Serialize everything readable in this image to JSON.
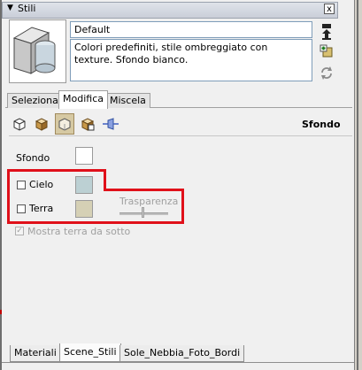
{
  "window": {
    "title": "Stili",
    "close_glyph": "x",
    "title_arrow_glyph": "▼"
  },
  "style_header": {
    "name": "Default",
    "description": "Colori predefiniti, stile ombreggiato con texture. Sfondo bianco."
  },
  "tabs": [
    {
      "label": "Seleziona"
    },
    {
      "label": "Modifica",
      "active": true
    },
    {
      "label": "Miscela"
    }
  ],
  "toolbar": {
    "icons": [
      "edge-settings-icon",
      "face-settings-icon",
      "background-settings-icon",
      "watermark-settings-icon",
      "modeling-settings-icon"
    ],
    "section_title": "Sfondo"
  },
  "background_settings": {
    "sfondo_label": "Sfondo",
    "sfondo_color": "#ffffff",
    "cielo_label": "Cielo",
    "cielo_checked": false,
    "cielo_color": "#bcd0d3",
    "terra_label": "Terra",
    "terra_checked": false,
    "terra_color": "#d5d0b5",
    "trasparenza_label": "Trasparenza",
    "mostra_label": "Mostra terra da sotto",
    "mostra_checked": true
  },
  "bottom_tabs": [
    {
      "label": "Materiali"
    },
    {
      "label": "Scene_Stili",
      "active": true
    },
    {
      "label": "Sole_Nebbia_Foto_Bordi"
    }
  ],
  "colors": {
    "highlight_box": "#e0101a",
    "selected_icon_bg": "#d6c9a3"
  }
}
